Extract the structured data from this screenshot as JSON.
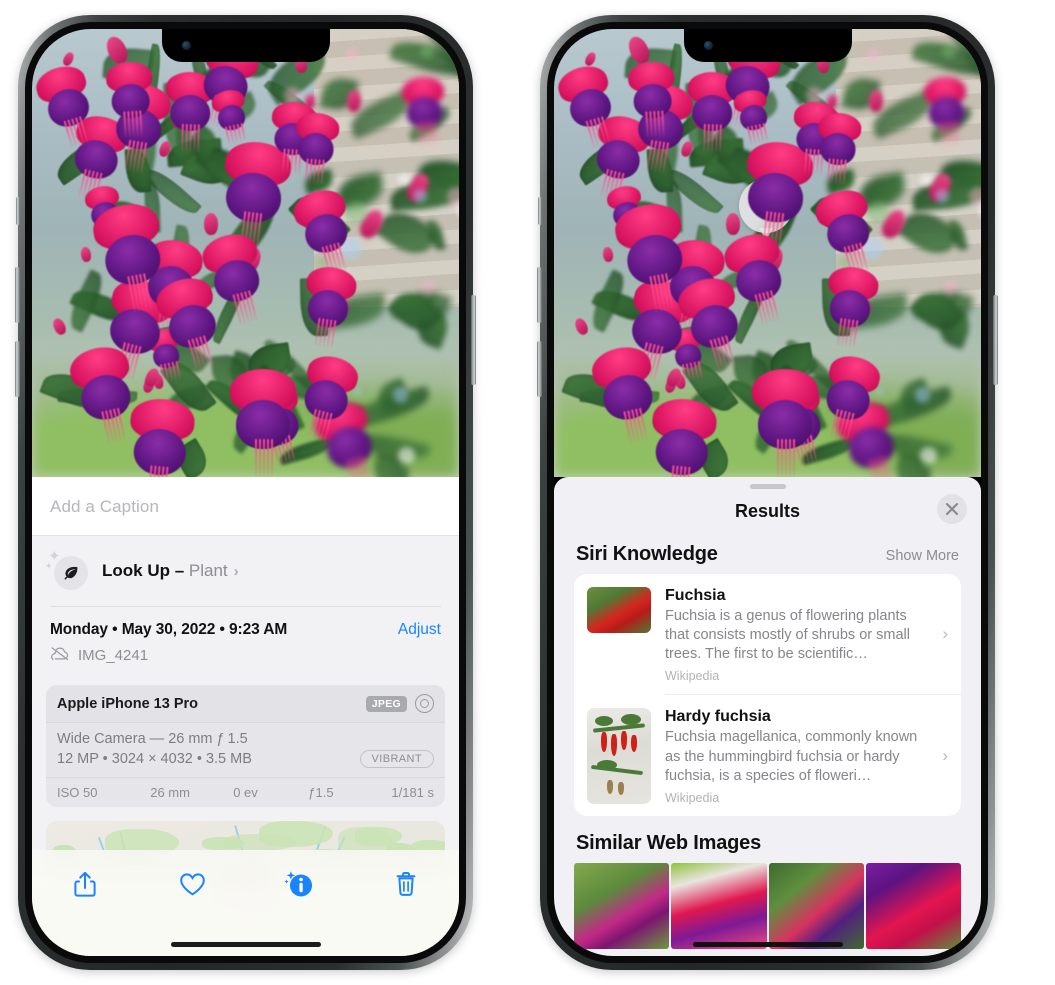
{
  "left_phone": {
    "caption_placeholder": "Add a Caption",
    "look_up": {
      "label_bold": "Look Up – ",
      "label_subject": "Plant",
      "chevron": "›",
      "icon": "leaf-icon"
    },
    "metadata": {
      "date": "Monday • May 30, 2022 • 9:23 AM",
      "adjust_label": "Adjust",
      "filename": "IMG_4241",
      "cloud_icon": "icloud-slash-icon"
    },
    "camera_card": {
      "device": "Apple iPhone 13 Pro",
      "format_badge": "JPEG",
      "aperture_icon": "aperture-icon",
      "lens": "Wide Camera — 26 mm ƒ 1.5",
      "dimensions": "12 MP • 3024 × 4032 • 3.5 MB",
      "style_badge": "VIBRANT",
      "exif": [
        "ISO 50",
        "26 mm",
        "0 ev",
        "ƒ1.5",
        "1/181 s"
      ]
    },
    "toolbar": [
      {
        "name": "share-button",
        "glyph": "share"
      },
      {
        "name": "favorite-button",
        "glyph": "heart"
      },
      {
        "name": "info-button",
        "glyph": "info-sparkle"
      },
      {
        "name": "delete-button",
        "glyph": "trash"
      }
    ]
  },
  "right_phone": {
    "visual_lookup_badge": "leaf-icon",
    "sheet": {
      "title": "Results",
      "close_label": "✕"
    },
    "siri_knowledge": {
      "section_title": "Siri Knowledge",
      "show_more": "Show More",
      "items": [
        {
          "title": "Fuchsia",
          "description": "Fuchsia is a genus of flowering plants that consists mostly of shrubs or small trees. The first to be scientific…",
          "source": "Wikipedia",
          "chevron": "›"
        },
        {
          "title": "Hardy fuchsia",
          "description": "Fuchsia magellanica, commonly known as the hummingbird fuchsia or hardy fuchsia, is a species of floweri…",
          "source": "Wikipedia",
          "chevron": "›"
        }
      ]
    },
    "similar_web_images": {
      "section_title": "Similar Web Images",
      "count": 4
    }
  },
  "colors": {
    "accent_blue": "#1a84ff",
    "sheet_bg": "#f1f1f5",
    "card_bg": "#e6e6ea",
    "secondary_text": "#8e8e93"
  }
}
